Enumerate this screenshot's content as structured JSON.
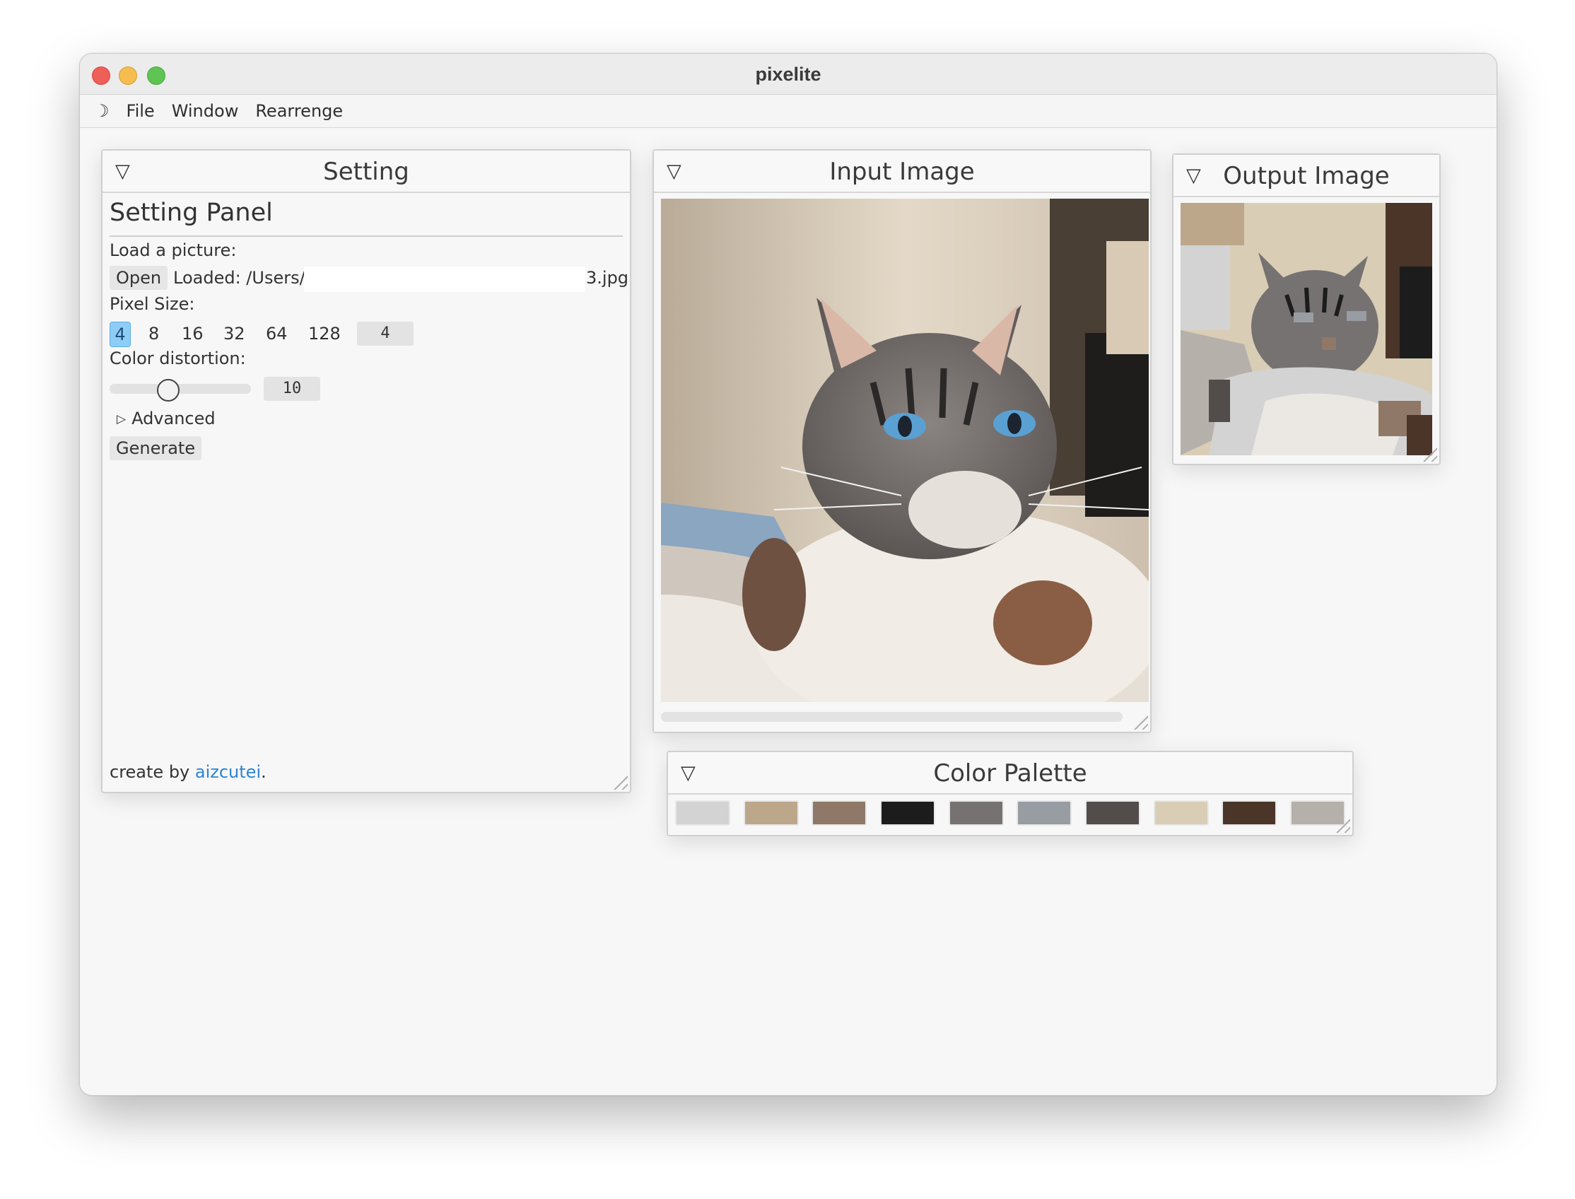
{
  "window": {
    "title": "pixelite"
  },
  "menu": {
    "theme_icon": "☽",
    "items": [
      "File",
      "Window",
      "Rearrenge"
    ]
  },
  "setting": {
    "header": "Setting",
    "title": "Setting Panel",
    "load_label": "Load a  picture:",
    "open_button": "Open",
    "loaded_prefix": "Loaded: /Users/:",
    "loaded_suffix": "3.jpg",
    "pixel_size_label": "Pixel Size:",
    "pixel_sizes": [
      "4",
      "8",
      "16",
      "32",
      "64",
      "128"
    ],
    "pixel_size_value": "4",
    "color_distortion_label": "Color distortion:",
    "color_distortion_value": "10",
    "advanced_label": "Advanced",
    "advanced_arrow": "▷",
    "generate_button": "Generate",
    "footer_prefix": "create by ",
    "footer_link": "aizcutei",
    "footer_suffix": "."
  },
  "input_image": {
    "header": "Input Image"
  },
  "output_image": {
    "header": "Output Image"
  },
  "palette": {
    "header": "Color Palette",
    "colors": [
      "#d3d3d3",
      "#bda78b",
      "#8f7868",
      "#1c1c1c",
      "#767271",
      "#989ca3",
      "#524c4b",
      "#d9cdb6",
      "#4a3528",
      "#b6b0ab"
    ]
  },
  "panel_collapse_icon": "▽"
}
